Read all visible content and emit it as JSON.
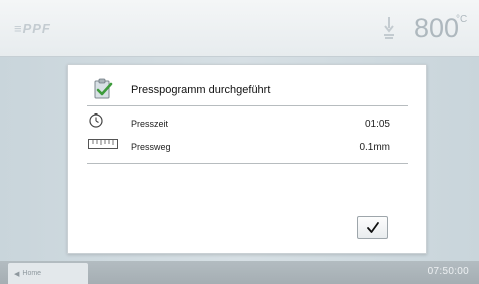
{
  "header": {
    "logo": "≡PPF",
    "temperature": "800",
    "temperature_unit": "°C"
  },
  "dialog": {
    "title": "Presspogramm durchgeführt",
    "rows": [
      {
        "icon": "stopwatch-icon",
        "label": "Presszeit",
        "value": "01:05"
      },
      {
        "icon": "ruler-icon",
        "label": "Pressweg",
        "value": "0.1mm"
      }
    ],
    "confirm_label": "✓"
  },
  "footer": {
    "home_label": "Home",
    "time": "07:50:00"
  }
}
